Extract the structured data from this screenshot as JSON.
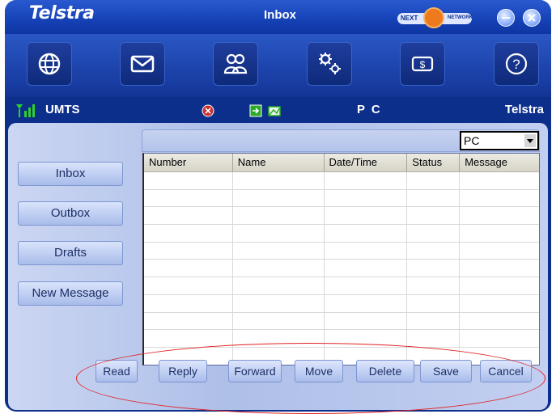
{
  "window": {
    "brand": "Telstra",
    "title": "Inbox"
  },
  "network_logo": {
    "text_left": "NEXT",
    "text_right": "NETWORK"
  },
  "status": {
    "network_type": "UMTS",
    "connection": "P C",
    "operator": "Telstra"
  },
  "sidebar": {
    "items": [
      "Inbox",
      "Outbox",
      "Drafts",
      "New Message"
    ]
  },
  "storage_select": {
    "value": "PC"
  },
  "table": {
    "columns": [
      "Number",
      "Name",
      "Date/Time",
      "Status",
      "Message"
    ],
    "row_count": 11
  },
  "actions": [
    "Read",
    "Reply",
    "Forward",
    "Move",
    "Delete",
    "Save",
    "Cancel"
  ],
  "toolbar": {
    "icons": [
      "globe-icon",
      "envelope-icon",
      "contacts-icon",
      "settings-gears-icon",
      "dollar-card-icon",
      "help-icon"
    ]
  },
  "colors": {
    "frame": "#0d2f8c",
    "accent": "#2a5ad0",
    "annotation": "#e02020"
  }
}
